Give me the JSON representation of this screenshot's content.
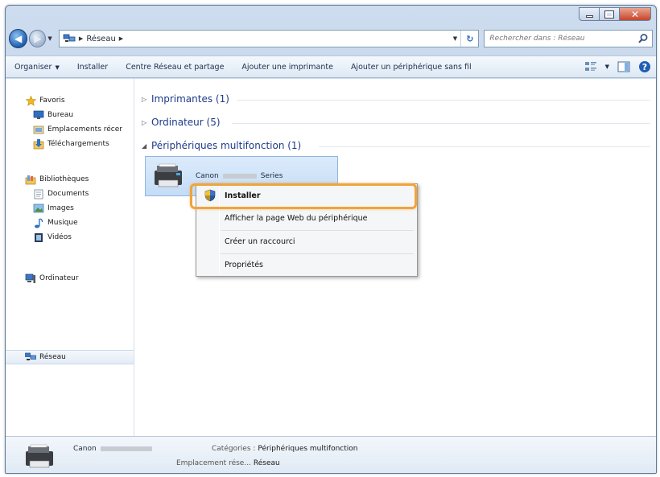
{
  "window": {
    "caption_buttons": [
      "minimize",
      "maximize",
      "close"
    ]
  },
  "address": {
    "crumb": "Réseau",
    "search_placeholder": "Rechercher dans : Réseau"
  },
  "toolbar": {
    "organize": "Organiser",
    "install": "Installer",
    "network_center": "Centre Réseau et partage",
    "add_printer": "Ajouter une imprimante",
    "add_wireless": "Ajouter un périphérique sans fil"
  },
  "nav": {
    "favorites": "Favoris",
    "desktop": "Bureau",
    "recent": "Emplacements récer",
    "downloads": "Téléchargements",
    "libraries": "Bibliothèques",
    "documents": "Documents",
    "images": "Images",
    "music": "Musique",
    "videos": "Vidéos",
    "computer": "Ordinateur",
    "network": "Réseau"
  },
  "groups": {
    "printers": "Imprimantes (1)",
    "computers": "Ordinateur (5)",
    "multifunction": "Périphériques multifonction (1)"
  },
  "device": {
    "brand": "Canon",
    "suffix": "Series"
  },
  "context_menu": {
    "install": "Installer",
    "web_page": "Afficher la page Web du périphérique",
    "shortcut": "Créer un raccourci",
    "properties": "Propriétés"
  },
  "details": {
    "name": "Canon",
    "categories_label": "Catégories :",
    "categories_value": "Périphériques multifonction",
    "location_label": "Emplacement rése...",
    "location_value": "Réseau"
  },
  "colors": {
    "highlight": "#f0a43c",
    "link_blue": "#1e3b8a",
    "window_frame": "#b9cde4"
  }
}
